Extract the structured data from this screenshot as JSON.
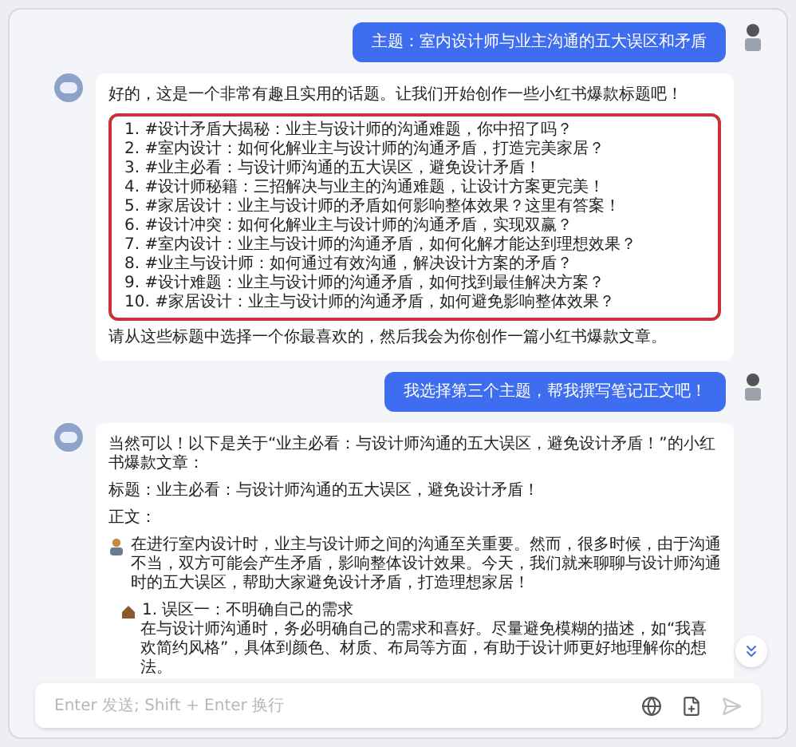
{
  "messages": [
    {
      "kind": "user",
      "text": "主题：室内设计师与业主沟通的五大误区和矛盾"
    },
    {
      "kind": "assistant",
      "intro": "好的，这是一个非常有趣且实用的话题。让我们开始创作一些小红书爆款标题吧！",
      "titles": [
        "1. #设计矛盾大揭秘：业主与设计师的沟通难题，你中招了吗？",
        "2. #室内设计：如何化解业主与设计师的沟通矛盾，打造完美家居？",
        "3. #业主必看：与设计师沟通的五大误区，避免设计矛盾！",
        "4. #设计师秘籍：三招解决与业主的沟通难题，让设计方案更完美！",
        "5. #家居设计：业主与设计师的矛盾如何影响整体效果？这里有答案！",
        "6. #设计冲突：如何化解业主与设计师的沟通矛盾，实现双赢？",
        "7. #室内设计：业主与设计师的沟通矛盾，如何化解才能达到理想效果？",
        "8. #业主与设计师：如何通过有效沟通，解决设计方案的矛盾？",
        "9. #设计难题：业主与设计师的沟通矛盾，如何找到最佳解决方案？",
        "10. #家居设计：业主与设计师的沟通矛盾，如何避免影响整体效果？"
      ],
      "outro": "请从这些标题中选择一个你最喜欢的，然后我会为你创作一篇小红书爆款文章。"
    },
    {
      "kind": "user",
      "text": "我选择第三个主题，帮我撰写笔记正文吧！"
    },
    {
      "kind": "assistant",
      "intro": "当然可以！以下是关于“业主必看：与设计师沟通的五大误区，避免设计矛盾！”的小红书爆款文章：",
      "heading": "标题：业主必看：与设计师沟通的五大误区，避免设计矛盾！",
      "label": "正文：",
      "paragraph": "在进行室内设计时，业主与设计师之间的沟通至关重要。然而，很多时候，由于沟通不当，双方可能会产生矛盾，影响整体设计效果。今天，我们就来聊聊与设计师沟通时的五大误区，帮助大家避免设计矛盾，打造理想家居！",
      "points": [
        {
          "title": "1. 误区一：不明确自己的需求",
          "body": "在与设计师沟通时，务必明确自己的需求和喜好。尽量避免模糊的描述，如“我喜欢简约风格”，具体到颜色、材质、布局等方面，有助于设计师更好地理解你的想法。"
        }
      ]
    }
  ],
  "input": {
    "placeholder": "Enter 发送; Shift + Enter 换行"
  }
}
